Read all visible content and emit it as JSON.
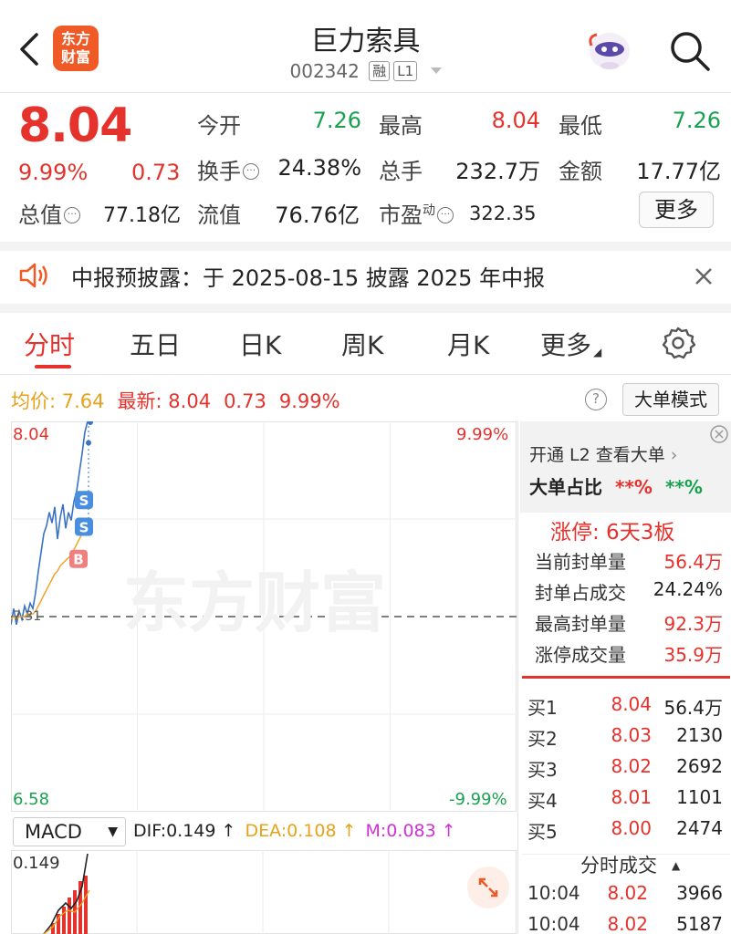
{
  "header": {
    "logo_line1": "东方",
    "logo_line2": "财富",
    "stock_name": "巨力索具",
    "stock_code": "002342",
    "tag_rong": "融",
    "tag_level": "L1"
  },
  "quote": {
    "price": "8.04",
    "change_pct": "9.99%",
    "change_amt": "0.73",
    "open_label": "今开",
    "open_value": "7.26",
    "high_label": "最高",
    "high_value": "8.04",
    "low_label": "最低",
    "low_value": "7.26",
    "turnover_label": "换手",
    "turnover_value": "24.38%",
    "volume_label": "总手",
    "volume_value": "232.7万",
    "amount_label": "金额",
    "amount_value": "17.77亿",
    "mktcap_label": "总值",
    "mktcap_value": "77.18亿",
    "float_label": "流值",
    "float_value": "76.76亿",
    "pe_label": "市盈",
    "pe_super": "动",
    "pe_value": "322.35",
    "more_label": "更多"
  },
  "notice": {
    "text": "中报预披露：于 2025-08-15 披露 2025 年中报"
  },
  "tabs": [
    {
      "label": "分时"
    },
    {
      "label": "五日"
    },
    {
      "label": "日K"
    },
    {
      "label": "周K"
    },
    {
      "label": "月K"
    },
    {
      "label": "更多"
    }
  ],
  "chart_bar": {
    "avg_label": "均价: ",
    "avg_value": "7.64",
    "latest_label": "最新: ",
    "latest_value": "8.04",
    "latest_change": "0.73",
    "latest_pct": "9.99%",
    "dadan_label": "大单模式",
    "help": "?"
  },
  "chart_data": {
    "type": "line",
    "y_top": "8.04",
    "y_bottom": "6.58",
    "pct_top": "9.99%",
    "pct_bottom": "-9.99%",
    "baseline": "7.31",
    "ylim": [
      6.58,
      8.04
    ],
    "series": [
      {
        "values": [
          7.28,
          7.34,
          7.28,
          7.33,
          7.3,
          7.35,
          7.32,
          7.36,
          7.34,
          7.4,
          7.48,
          7.55,
          7.62,
          7.65,
          7.7,
          7.66,
          7.72,
          7.6,
          7.68,
          7.73,
          7.64,
          7.7,
          7.67,
          7.74,
          7.78,
          7.85,
          7.92,
          8.0,
          8.04,
          8.04
        ]
      },
      {
        "values": [
          7.3,
          7.31,
          7.3,
          7.31,
          7.31,
          7.31,
          7.32,
          7.32,
          7.32,
          7.33,
          7.35,
          7.37,
          7.39,
          7.41,
          7.43,
          7.45,
          7.47,
          7.48,
          7.5,
          7.51,
          7.52,
          7.53,
          7.54,
          7.56,
          7.58,
          7.6,
          7.62,
          7.64,
          7.64,
          7.64
        ]
      }
    ],
    "markers": [
      "S",
      "S",
      "B"
    ],
    "watermark": "东方财富"
  },
  "macd": {
    "selector": "MACD",
    "dif": "DIF:0.149 ↑",
    "dea": "DEA:0.108 ↑",
    "m": "M:0.083 ↑",
    "top_value": "0.149"
  },
  "panel": {
    "l2_text": "开通 L2 查看大单",
    "ratio_label": "大单占比",
    "ratio_red": "**%",
    "ratio_green": "**%",
    "limit_title": "涨停: 6天3板",
    "rows": [
      {
        "label": "当前封单量",
        "value": "56.4万",
        "color": "red"
      },
      {
        "label": "封单占成交",
        "value": "24.24%",
        "color": "dark"
      },
      {
        "label": "最高封单量",
        "value": "92.3万",
        "color": "red"
      },
      {
        "label": "涨停成交量",
        "value": "35.9万",
        "color": "red"
      }
    ],
    "book": [
      {
        "label": "买1",
        "price": "8.04",
        "vol": "56.4万"
      },
      {
        "label": "买2",
        "price": "8.03",
        "vol": "2130"
      },
      {
        "label": "买3",
        "price": "8.02",
        "vol": "2692"
      },
      {
        "label": "买4",
        "price": "8.01",
        "vol": "1101"
      },
      {
        "label": "买5",
        "price": "8.00",
        "vol": "2474"
      }
    ],
    "trades_title": "分时成交",
    "trades": [
      {
        "time": "10:04",
        "price": "8.02",
        "vol": "3966",
        "vol_color": "green"
      },
      {
        "time": "10:04",
        "price": "8.02",
        "vol": "5187",
        "vol_color": "green"
      }
    ]
  }
}
